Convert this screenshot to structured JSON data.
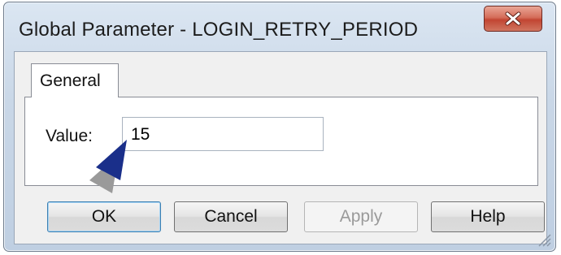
{
  "window": {
    "title": "Global Parameter - LOGIN_RETRY_PERIOD",
    "close_icon": "close-icon"
  },
  "tabs": [
    {
      "label": "General",
      "selected": true
    }
  ],
  "form": {
    "value_label": "Value:",
    "value": "15"
  },
  "buttons": {
    "ok_label": "OK",
    "cancel_label": "Cancel",
    "apply_label": "Apply",
    "apply_enabled": false,
    "help_label": "Help"
  },
  "annotation": {
    "pointer_icon": "arrow-pointer-icon",
    "pointer_color": "#1a2f8a"
  },
  "colors": {
    "close_button": "#c94a38",
    "titlebar": "#cfdcec",
    "dialog_background": "#f0f0f0"
  }
}
